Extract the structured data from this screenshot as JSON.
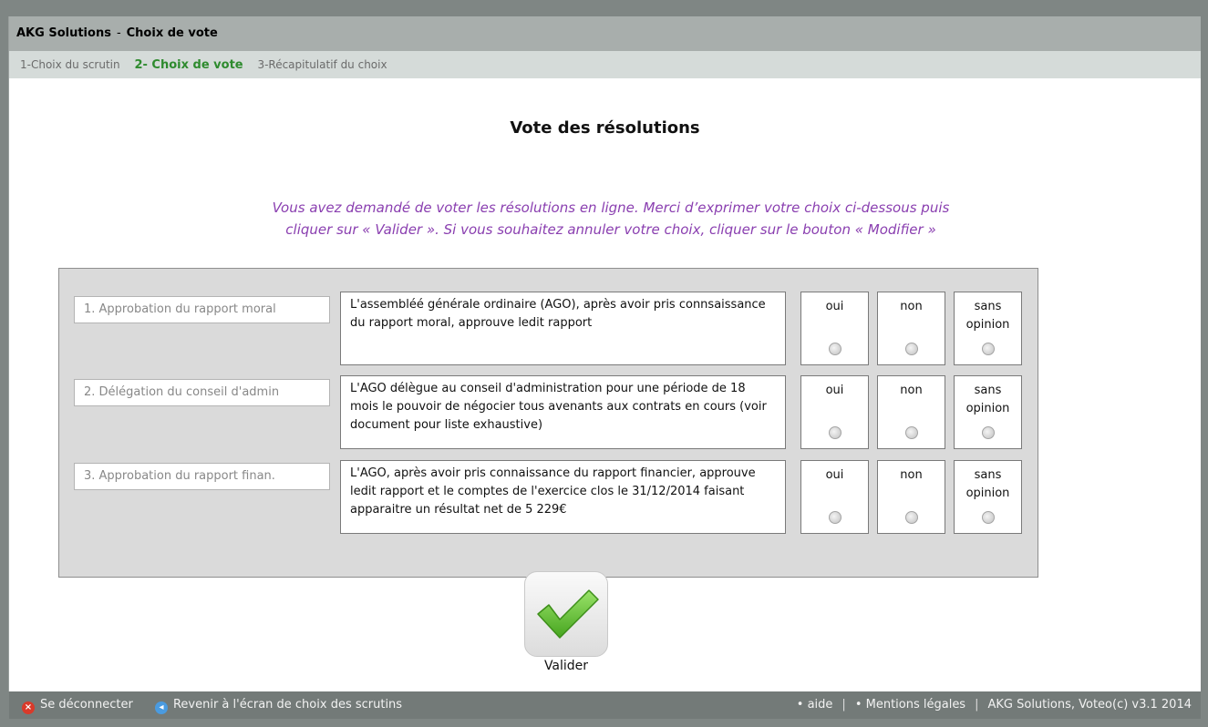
{
  "header": {
    "app": "AKG Solutions",
    "sep": "-",
    "title": "Choix de vote"
  },
  "steps": [
    {
      "label": "1-Choix du scrutin",
      "active": false
    },
    {
      "label": "2- Choix de vote",
      "active": true
    },
    {
      "label": "3-Récapitulatif du choix",
      "active": false
    }
  ],
  "main": {
    "title": "Vote des résolutions",
    "intro_line1": "Vous avez demandé de voter les résolutions en ligne. Merci d’exprimer votre choix ci-dessous puis",
    "intro_line2": "cliquer sur « Valider ». Si vous souhaitez annuler votre choix, cliquer sur le bouton « Modifier »"
  },
  "resolutions": [
    {
      "label": "1. Approbation du rapport moral",
      "description": "L'assembléé générale ordinaire (AGO), après avoir pris connsaissance du rapport moral, approuve ledit rapport",
      "options": {
        "yes": "oui",
        "no": "non",
        "none_1": "sans",
        "none_2": "opinion"
      }
    },
    {
      "label": "2. Délégation du conseil d'admin",
      "description": "L'AGO délègue au conseil d'administration pour une période de 18 mois le pouvoir de négocier tous avenants aux contrats en cours (voir document pour liste exhaustive)",
      "options": {
        "yes": "oui",
        "no": "non",
        "none_1": "sans",
        "none_2": "opinion"
      }
    },
    {
      "label": "3. Approbation du rapport finan.",
      "description": "L'AGO, après avoir pris connaissance du rapport financier, approuve ledit rapport et le comptes de l'exercice clos le 31/12/2014 faisant apparaitre un résultat net de 5 229€",
      "options": {
        "yes": "oui",
        "no": "non",
        "none_1": "sans",
        "none_2": "opinion"
      }
    }
  ],
  "validate": {
    "label": "Valider"
  },
  "footer": {
    "logout": "Se déconnecter",
    "back": "Revenir à l'écran de choix des scrutins",
    "help": "• aide",
    "divider": "|",
    "legal": "• Mentions légales",
    "copyright": "AKG Solutions, Voteo(c) v3.1 2014"
  },
  "colors": {
    "active_step": "#2e8b2e",
    "intro_text": "#8a3fb0",
    "check_green": "#5cbf2e"
  },
  "icons": {
    "logout": "close-icon",
    "back": "back-arrow-icon",
    "validate": "checkmark-icon"
  }
}
